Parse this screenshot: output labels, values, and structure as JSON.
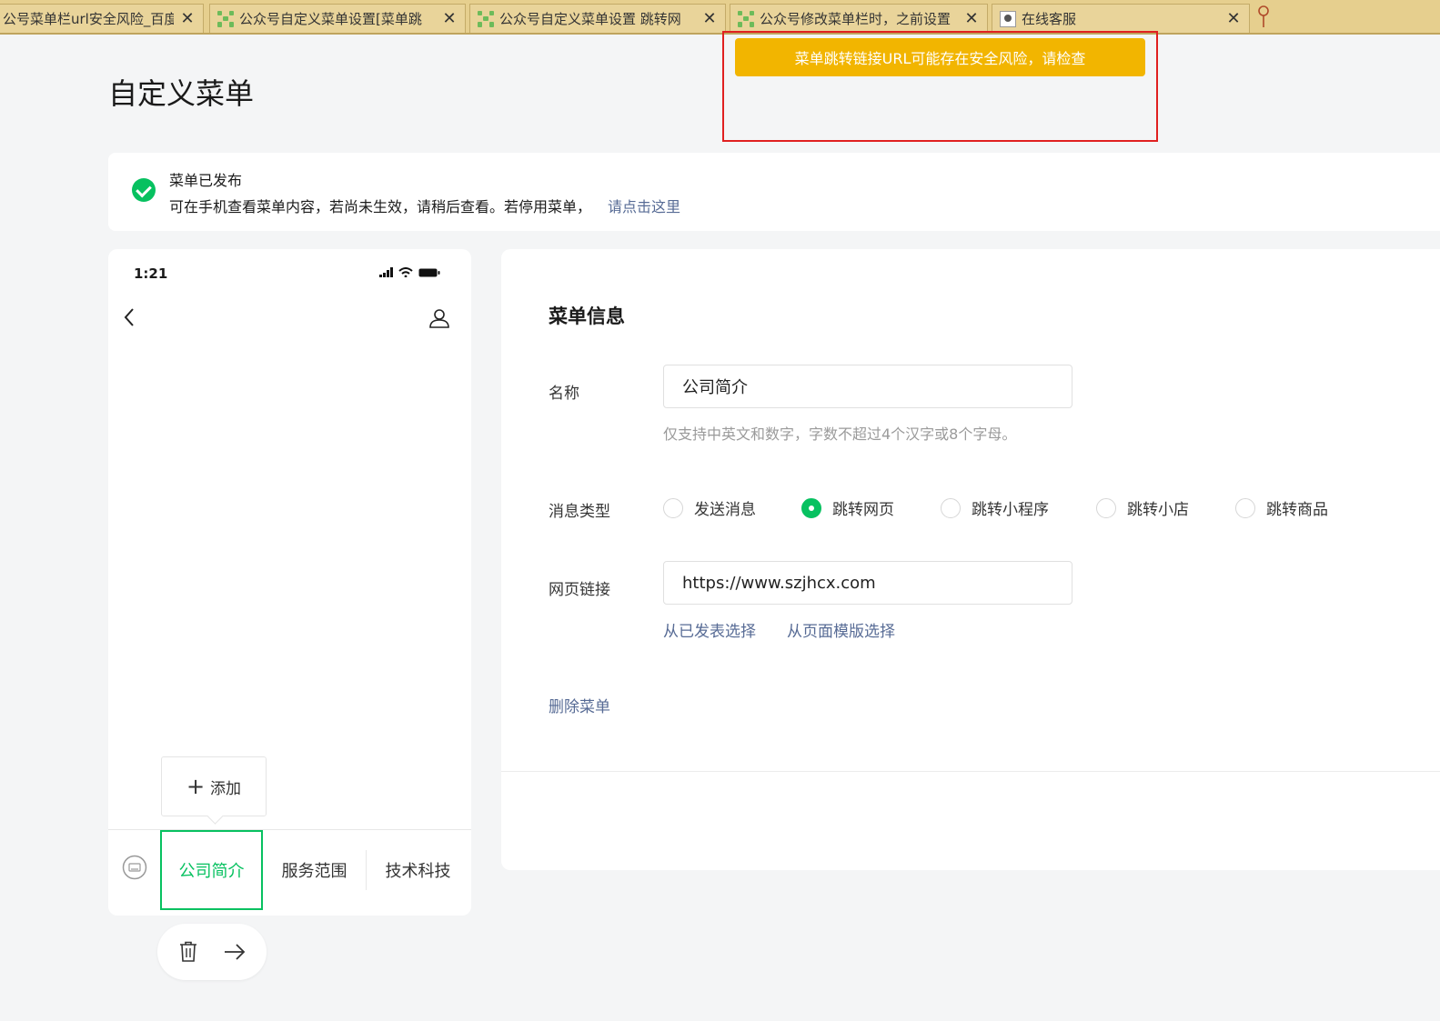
{
  "browser": {
    "tabs": [
      {
        "title": "公号菜单栏url安全风险_百度",
        "close": "✕",
        "icon": "baidu-page-icon"
      },
      {
        "title": "公众号自定义菜单设置[菜单跳",
        "close": "✕",
        "icon": "site-grid-icon"
      },
      {
        "title": "公众号自定义菜单设置 跳转网",
        "close": "✕",
        "icon": "site-grid-icon"
      },
      {
        "title": "公众号修改菜单栏时，之前设置",
        "close": "✕",
        "icon": "site-grid-icon"
      },
      {
        "title": "在线客服",
        "close": "✕",
        "icon": "chat-page-icon"
      }
    ]
  },
  "warning": {
    "text": "菜单跳转链接URL可能存在安全风险，请检查",
    "color": "#f2b500"
  },
  "page": {
    "title": "自定义菜单"
  },
  "notice": {
    "title": "菜单已发布",
    "text": "可在手机查看菜单内容，若尚未生效，请稍后查看。若停用菜单，",
    "link": "请点击这里"
  },
  "phone": {
    "time": "1:21",
    "add_label": "添加",
    "menus": [
      {
        "label": "公司简介",
        "active": true
      },
      {
        "label": "服务范围",
        "active": false
      },
      {
        "label": "技术科技",
        "active": false
      }
    ]
  },
  "form": {
    "section_title": "菜单信息",
    "name_label": "名称",
    "name_value": "公司简介",
    "name_hint": "仅支持中英文和数字，字数不超过4个汉字或8个字母。",
    "type_label": "消息类型",
    "types": [
      {
        "label": "发送消息",
        "selected": false
      },
      {
        "label": "跳转网页",
        "selected": true
      },
      {
        "label": "跳转小程序",
        "selected": false
      },
      {
        "label": "跳转小店",
        "selected": false
      },
      {
        "label": "跳转商品",
        "selected": false
      }
    ],
    "url_label": "网页链接",
    "url_value": "https://www.szjhcx.com",
    "pick_published": "从已发表选择",
    "pick_template": "从页面模版选择",
    "delete_label": "删除菜单"
  },
  "colors": {
    "accent": "#07c160",
    "link": "#576b95",
    "warning_frame": "#e02020"
  }
}
